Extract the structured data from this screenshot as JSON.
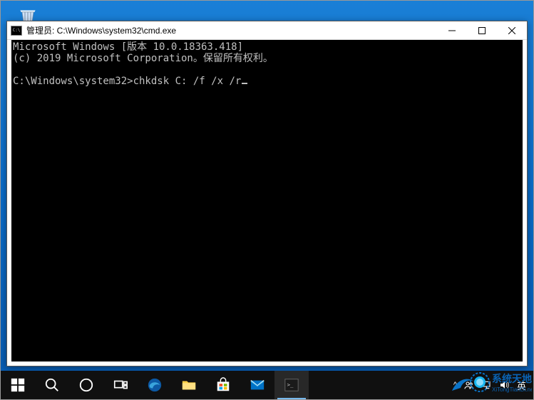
{
  "window": {
    "title": "管理员: C:\\Windows\\system32\\cmd.exe"
  },
  "console": {
    "line1": "Microsoft Windows [版本 10.0.18363.418]",
    "line2": "(c) 2019 Microsoft Corporation。保留所有权利。",
    "blank": "",
    "prompt_prefix": "C:\\Windows\\system32>",
    "command": "chkdsk C: /f /x /r"
  },
  "taskbar": {
    "ime": "英",
    "tray_chevron": "^"
  },
  "watermark": {
    "brand_top": "系统天地",
    "brand_bottom": "XiTongTianDi.net"
  }
}
